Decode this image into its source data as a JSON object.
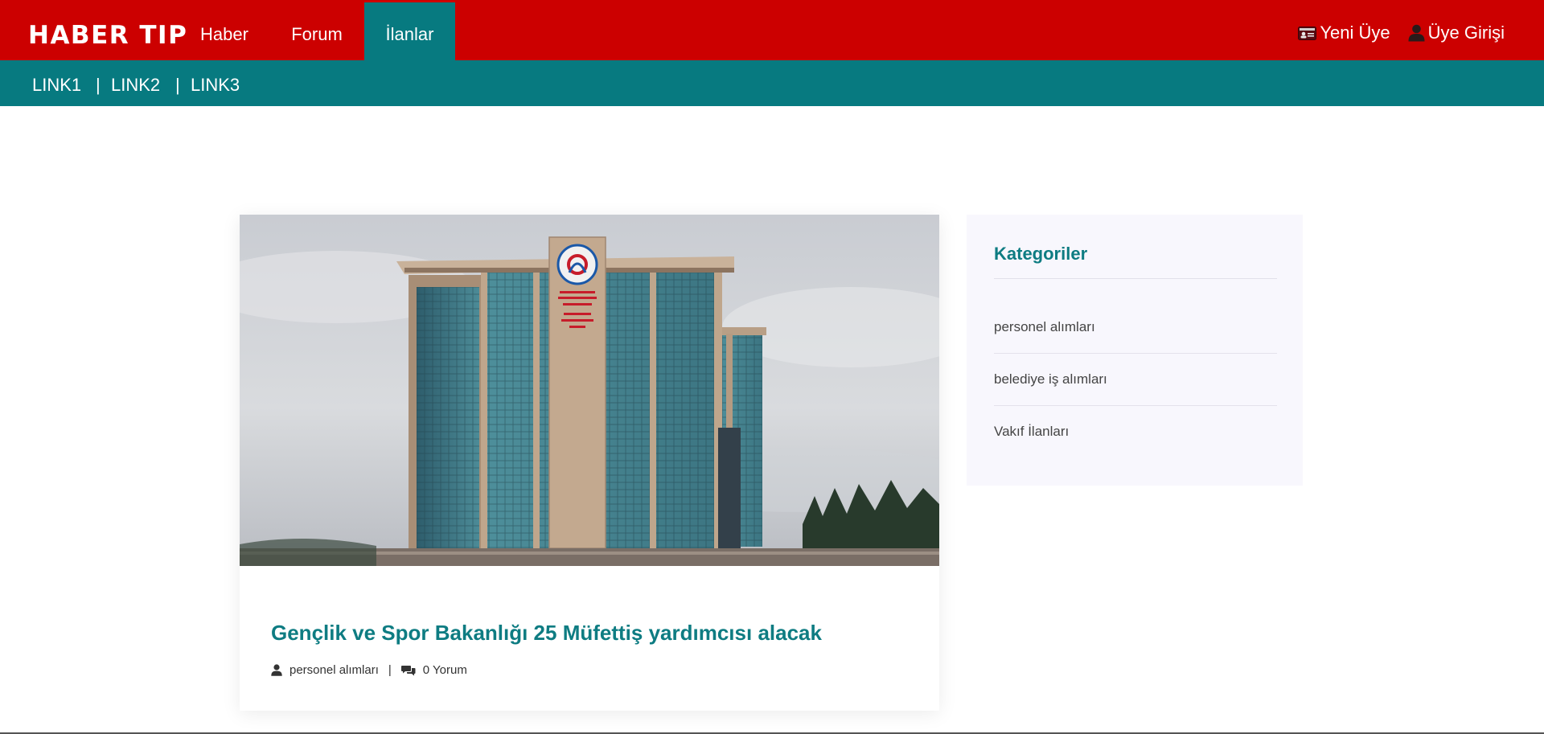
{
  "header": {
    "logo": "HABER TIP",
    "nav": [
      {
        "label": "Haber"
      },
      {
        "label": "Forum"
      },
      {
        "label": "İlanlar"
      }
    ],
    "register_label": "Yeni Üye",
    "login_label": "Üye Girişi",
    "colors": {
      "primary": "#cc0000",
      "accent": "#077a80"
    }
  },
  "subnav": {
    "links": [
      {
        "label": "LINK1"
      },
      {
        "label": "LINK2"
      },
      {
        "label": "LINK3"
      }
    ],
    "separator": "|"
  },
  "article": {
    "title": "Gençlik ve Spor Bakanlığı 25 Müfettiş yardımcısı alacak",
    "category": "personel alımları",
    "separator": "|",
    "comments": "0 Yorum"
  },
  "sidebar": {
    "title": "Kategoriler",
    "items": [
      {
        "label": "personel alımları"
      },
      {
        "label": "belediye iş alımları"
      },
      {
        "label": "Vakıf İlanları"
      }
    ]
  }
}
